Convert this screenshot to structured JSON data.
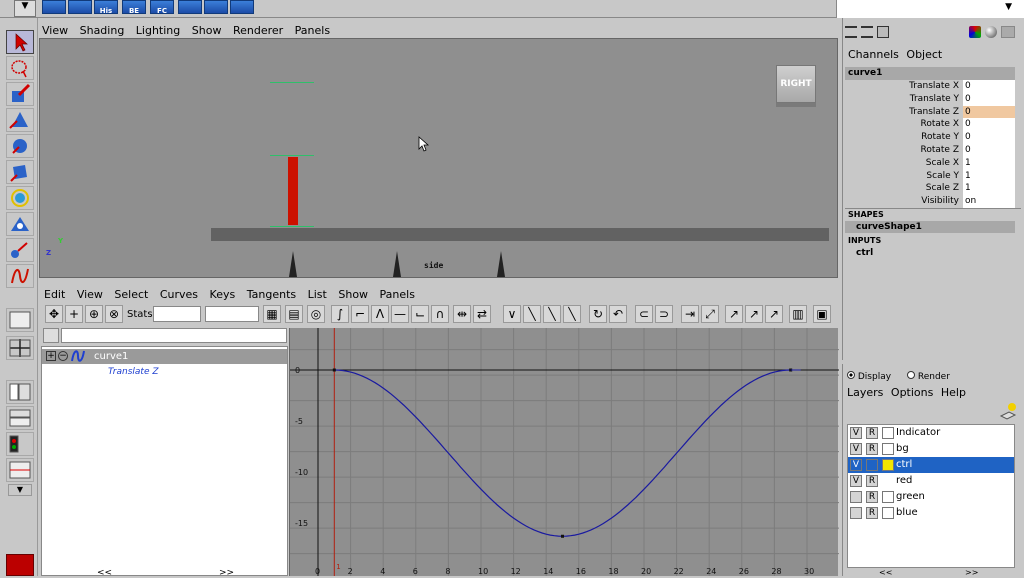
{
  "shelf": {
    "items": [
      "His",
      "BE",
      "FC"
    ]
  },
  "viewport": {
    "menu": [
      "View",
      "Shading",
      "Lighting",
      "Show",
      "Renderer",
      "Panels"
    ],
    "viewcube_label": "RIGHT",
    "camera_label": "side",
    "axis_y": "Y",
    "axis_z": "Z"
  },
  "graph_editor": {
    "menu": [
      "Edit",
      "View",
      "Select",
      "Curves",
      "Keys",
      "Tangents",
      "List",
      "Show",
      "Panels"
    ],
    "stats_label": "Stats",
    "outliner": {
      "node": "curve1",
      "attribute": "Translate Z"
    },
    "scroll_left": "<<",
    "scroll_right": ">>",
    "y_ticks": [
      "0",
      "-5",
      "-10",
      "-15"
    ],
    "x_ticks": [
      "0",
      "2",
      "4",
      "6",
      "8",
      "10",
      "12",
      "14",
      "16",
      "18",
      "20",
      "22",
      "24",
      "26",
      "28",
      "30"
    ],
    "current_frame": "1"
  },
  "channel_box": {
    "tabs": [
      "Channels",
      "Object"
    ],
    "node": "curve1",
    "attributes": [
      {
        "label": "Translate X",
        "value": "0"
      },
      {
        "label": "Translate Y",
        "value": "0"
      },
      {
        "label": "Translate Z",
        "value": "0"
      },
      {
        "label": "Rotate X",
        "value": "0"
      },
      {
        "label": "Rotate Y",
        "value": "0"
      },
      {
        "label": "Rotate Z",
        "value": "0"
      },
      {
        "label": "Scale X",
        "value": "1"
      },
      {
        "label": "Scale Y",
        "value": "1"
      },
      {
        "label": "Scale Z",
        "value": "1"
      },
      {
        "label": "Visibility",
        "value": "on"
      }
    ],
    "shapes_header": "SHAPES",
    "shape_node": "curveShape1",
    "inputs_header": "INPUTS",
    "input_node": "ctrl"
  },
  "layer_editor": {
    "modes": [
      "Display",
      "Render"
    ],
    "menu": [
      "Layers",
      "Options",
      "Help"
    ],
    "layers": [
      {
        "v": "V",
        "r": "R",
        "name": "Indicator",
        "color": ""
      },
      {
        "v": "V",
        "r": "R",
        "name": "bg",
        "color": ""
      },
      {
        "v": "V",
        "r": "",
        "name": "ctrl",
        "color": "#f2e600"
      },
      {
        "v": "V",
        "r": "R",
        "name": "red",
        "color": ""
      },
      {
        "v": "",
        "r": "R",
        "name": "green",
        "color": ""
      },
      {
        "v": "",
        "r": "R",
        "name": "blue",
        "color": ""
      }
    ],
    "scroll_left": "<<",
    "scroll_right": ">>"
  },
  "colors": {
    "accent_select": "#1f63c4",
    "red_object": "#cc1100",
    "curve": "#1a1aa0",
    "highlight_field": "#f0c8a0"
  }
}
